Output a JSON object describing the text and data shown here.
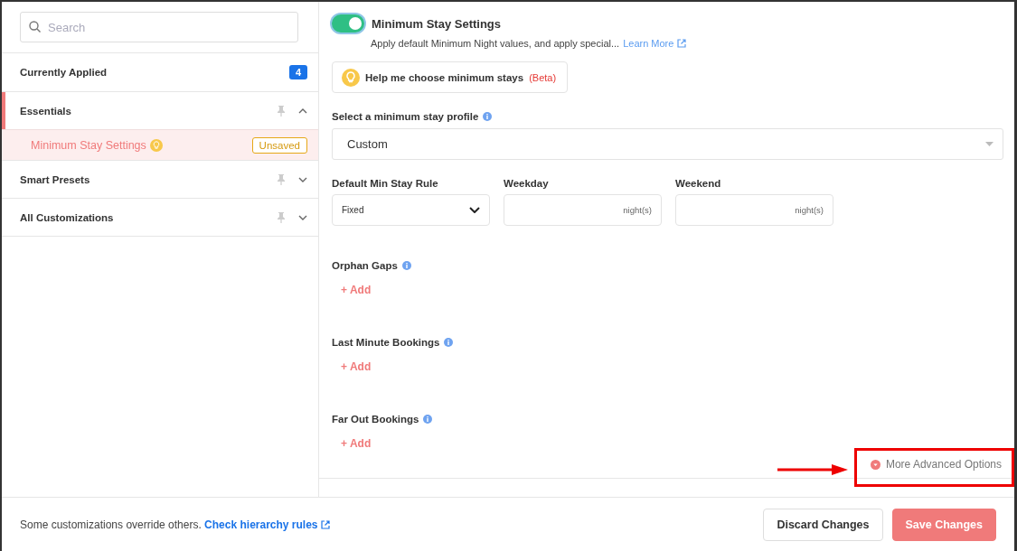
{
  "search": {
    "placeholder": "Search"
  },
  "sidebar": {
    "items": [
      {
        "label": "Currently Applied",
        "kind": "count",
        "count": "4",
        "selected": false
      },
      {
        "label": "Essentials",
        "kind": "group",
        "expanded": true,
        "selected": true,
        "children": [
          {
            "label": "Minimum Stay Settings",
            "selected": true,
            "badge": "Unsaved"
          }
        ]
      },
      {
        "label": "Smart Presets",
        "kind": "group",
        "expanded": false,
        "selected": false
      },
      {
        "label": "All Customizations",
        "kind": "group",
        "expanded": false,
        "selected": false
      }
    ]
  },
  "main": {
    "toggle": {
      "on": true,
      "title": "Minimum Stay Settings",
      "description": "Apply default Minimum Night values, and apply special...",
      "link": "Learn More"
    },
    "help_button": {
      "label": "Help me choose minimum stays",
      "tag": "(Beta)"
    },
    "profile": {
      "label": "Select a minimum stay profile",
      "value": "Custom"
    },
    "fields": [
      {
        "label": "Default Min Stay Rule",
        "kind": "select",
        "value": "Fixed"
      },
      {
        "label": "Weekday",
        "kind": "input",
        "unit": "night(s)"
      },
      {
        "label": "Weekend",
        "kind": "input",
        "unit": "night(s)"
      }
    ],
    "sections": [
      {
        "title": "Orphan Gaps",
        "action": "+ Add"
      },
      {
        "title": "Last Minute Bookings",
        "action": "+ Add"
      },
      {
        "title": "Far Out Bookings",
        "action": "+ Add"
      }
    ],
    "advanced": "More Advanced Options"
  },
  "footer": {
    "note": "Some customizations override others.",
    "link": "Check hierarchy rules",
    "buttons": [
      {
        "label": "Discard Changes",
        "kind": "secondary"
      },
      {
        "label": "Save Changes",
        "kind": "primary"
      }
    ]
  }
}
